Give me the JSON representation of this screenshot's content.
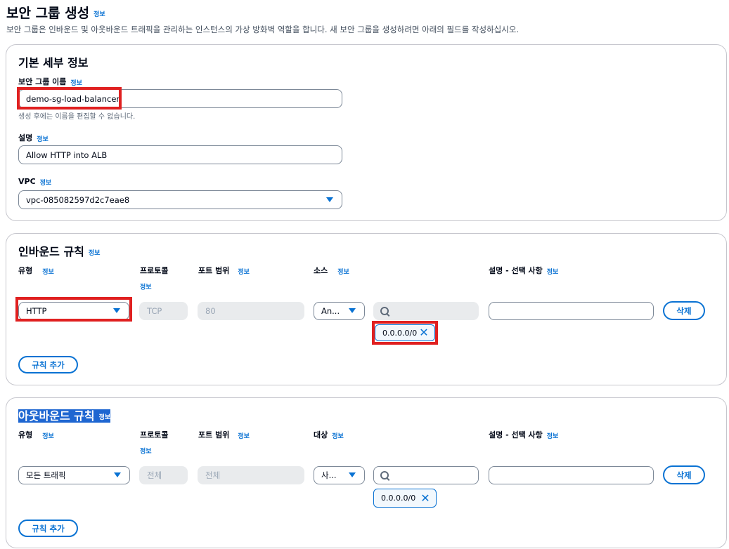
{
  "header": {
    "title": "보안 그룹 생성",
    "info": "정보",
    "subtitle": "보안 그룹은 인바운드 및 아웃바운드 트래픽을 관리하는 인스턴스의 가상 방화벽 역할을 합니다. 새 보안 그룹을 생성하려면 아래의 필드를 작성하십시오."
  },
  "basic": {
    "title": "기본 세부 정보",
    "name_label": "보안 그룹 이름",
    "name_info": "정보",
    "name_value": "demo-sg-load-balancer",
    "name_hint": "생성 후에는 이름을 편집할 수 없습니다.",
    "desc_label": "설명",
    "desc_info": "정보",
    "desc_value": "Allow HTTP into ALB",
    "vpc_label": "VPC",
    "vpc_info": "정보",
    "vpc_value": "vpc-085082597d2c7eae8"
  },
  "inbound": {
    "title": "인바운드 규칙",
    "info": "정보",
    "columns": {
      "type": "유형",
      "type_info": "정보",
      "protocol": "프로토콜",
      "protocol_info": "정보",
      "port": "포트 범위",
      "port_info": "정보",
      "source": "소스",
      "source_info": "정보",
      "desc": "설명 - 선택 사항",
      "desc_info": "정보"
    },
    "rule": {
      "type": "HTTP",
      "protocol": "TCP",
      "port": "80",
      "source": "An...",
      "token": "0.0.0.0/0",
      "delete": "삭제"
    },
    "add_rule": "규칙 추가"
  },
  "outbound": {
    "title": "아웃바운드 규칙",
    "info": "정보",
    "columns": {
      "type": "유형",
      "type_info": "정보",
      "protocol": "프로토콜",
      "protocol_info": "정보",
      "port": "포트 범위",
      "port_info": "정보",
      "dest": "대상",
      "dest_info": "정보",
      "desc": "설명 - 선택 사항",
      "desc_info": "정보"
    },
    "rule": {
      "type": "모든 트래픽",
      "protocol": "전체",
      "port": "전체",
      "dest": "사...",
      "token": "0.0.0.0/0",
      "delete": "삭제"
    },
    "add_rule": "규칙 추가"
  },
  "colors": {
    "accent": "#0972d3",
    "highlight": "#e02020",
    "selection": "#1e66d1"
  },
  "icons": [
    "info-link",
    "caret-down-icon",
    "search-icon",
    "close-icon"
  ]
}
